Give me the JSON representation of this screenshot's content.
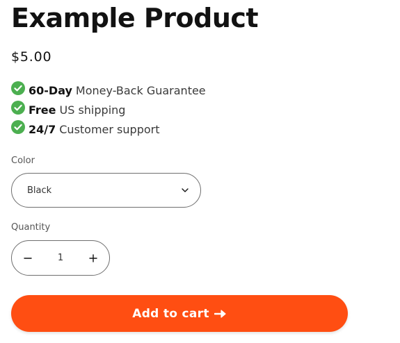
{
  "product": {
    "title": "Example Product",
    "price": "$5.00"
  },
  "benefits": [
    {
      "strong": "60-Day",
      "text": "Money-Back Guarantee",
      "icon": "check-circle-icon"
    },
    {
      "strong": "Free",
      "text": "US shipping",
      "icon": "check-circle-icon"
    },
    {
      "strong": "24/7",
      "text": "Customer support",
      "icon": "check-circle-icon"
    }
  ],
  "color": {
    "label": "Color",
    "selected": "Black"
  },
  "quantity": {
    "label": "Quantity",
    "value": "1",
    "decrease_icon": "minus-icon",
    "increase_icon": "plus-icon"
  },
  "cart": {
    "label": "Add to cart",
    "icon": "arrow-right-icon"
  },
  "colors": {
    "check_green": "#4caf50",
    "button_orange": "#ff4e12"
  }
}
